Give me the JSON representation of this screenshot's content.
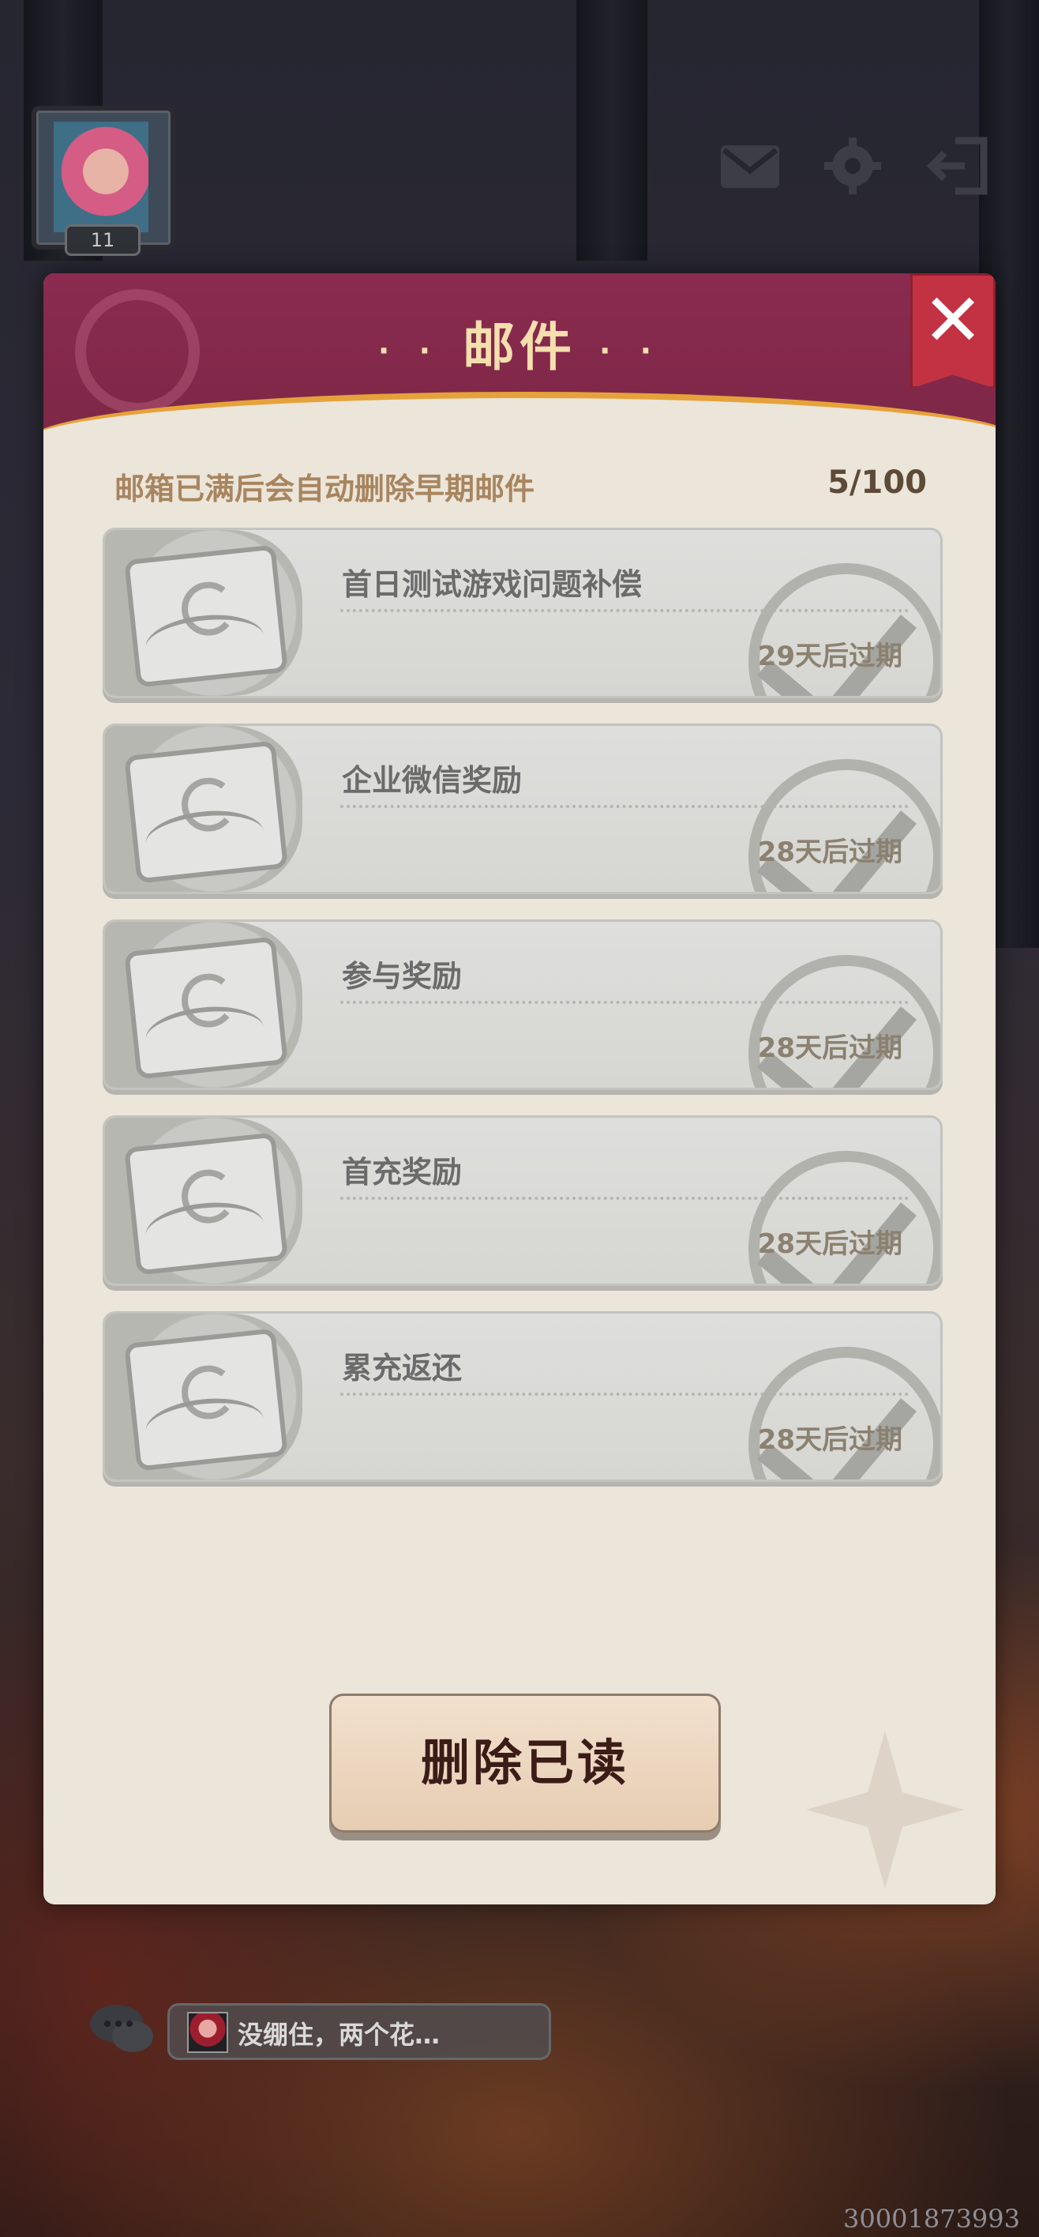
{
  "hud": {
    "level": "11",
    "icons": [
      "mail-icon",
      "gear-icon",
      "exit-icon"
    ]
  },
  "mail_panel": {
    "title": "邮件",
    "title_dots_left": "·  ·",
    "title_dots_right": "·  ·",
    "close_label": "✕",
    "notice": "邮箱已满后会自动删除早期邮件",
    "count": "5/100",
    "items": [
      {
        "title": "首日测试游戏问题补偿",
        "expire": "29天后过期"
      },
      {
        "title": "企业微信奖励",
        "expire": "28天后过期"
      },
      {
        "title": "参与奖励",
        "expire": "28天后过期"
      },
      {
        "title": "首充奖励",
        "expire": "28天后过期"
      },
      {
        "title": "累充返还",
        "expire": "28天后过期"
      }
    ],
    "delete_read_label": "删除已读"
  },
  "chat": {
    "preview": "没绷住，两个花…"
  },
  "uid": "30001873993",
  "colors": {
    "header": "#8a2b4f",
    "close": "#c23243",
    "panel_bg": "#ebe5da",
    "title_text": "#f6dfae"
  }
}
